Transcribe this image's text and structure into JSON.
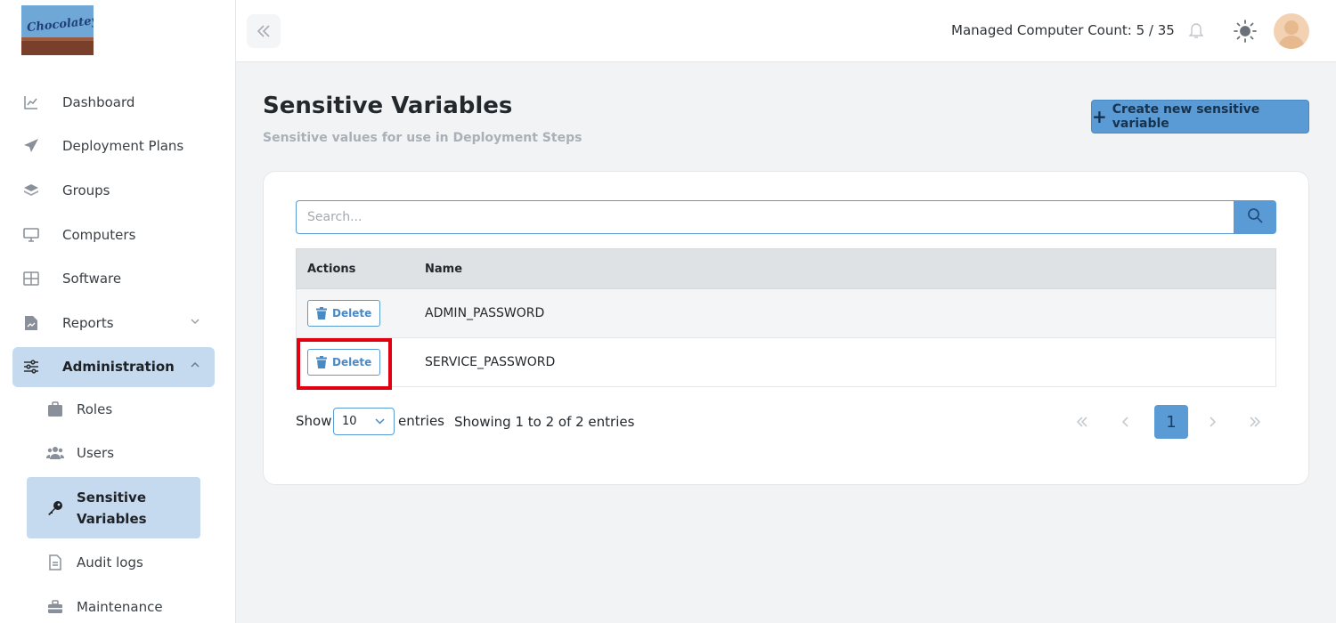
{
  "logo": {
    "text": "Chocolatey"
  },
  "sidebar": {
    "items": [
      {
        "label": "Dashboard",
        "icon": "chart-line-icon"
      },
      {
        "label": "Deployment Plans",
        "icon": "paper-plane-icon"
      },
      {
        "label": "Groups",
        "icon": "layers-icon"
      },
      {
        "label": "Computers",
        "icon": "desktop-icon"
      },
      {
        "label": "Software",
        "icon": "grid-icon"
      },
      {
        "label": "Reports",
        "icon": "report-icon"
      },
      {
        "label": "Administration",
        "icon": "sliders-icon"
      }
    ],
    "sub_items": [
      {
        "label": "Roles",
        "icon": "id-badge-icon"
      },
      {
        "label": "Users",
        "icon": "users-icon"
      },
      {
        "label": "Sensitive",
        "label2": "Variables",
        "icon": "key-icon"
      },
      {
        "label": "Audit logs",
        "icon": "file-icon"
      },
      {
        "label": "Maintenance",
        "icon": "toolbox-icon"
      }
    ]
  },
  "header": {
    "managed_count": "Managed Computer Count: 5 / 35"
  },
  "page": {
    "title": "Sensitive Variables",
    "subtitle": "Sensitive values for use in Deployment Steps",
    "create_label": "Create new sensitive variable"
  },
  "search": {
    "placeholder": "Search..."
  },
  "table": {
    "headers": {
      "actions": "Actions",
      "name": "Name"
    },
    "delete_label": "Delete",
    "rows": [
      {
        "name": "ADMIN_PASSWORD"
      },
      {
        "name": "SERVICE_PASSWORD"
      }
    ]
  },
  "footer": {
    "show": "Show",
    "entries_value": "10",
    "entries": "entries",
    "showing": "Showing 1 to 2 of 2 entries",
    "current_page": "1"
  },
  "colors": {
    "accent": "#5b9bd5",
    "active_bg": "#c5daef",
    "highlight": "#e0000f"
  }
}
